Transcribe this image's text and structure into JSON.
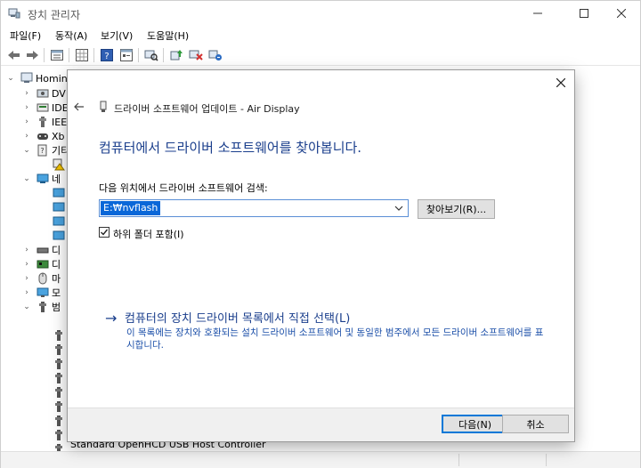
{
  "window": {
    "title": "장치 관리자"
  },
  "menu": {
    "items": [
      "파일(F)",
      "동작(A)",
      "보기(V)",
      "도움말(H)"
    ]
  },
  "toolbar": {
    "buttons": [
      "back-arrow-icon",
      "forward-arrow-icon",
      "properties-icon",
      "grid-icon",
      "help-icon",
      "details-icon",
      "scan-hardware-icon",
      "update-driver-icon",
      "disable-device-icon",
      "uninstall-device-icon"
    ]
  },
  "tree": {
    "root": "Homin",
    "items": [
      {
        "label": "DV",
        "icon": "dvd-drive-icon",
        "expanded": false
      },
      {
        "label": "IDE",
        "icon": "ide-controller-icon",
        "expanded": false
      },
      {
        "label": "IEE",
        "icon": "usb-controller-icon",
        "expanded": false
      },
      {
        "label": "Xb",
        "icon": "gamepad-icon",
        "expanded": false
      },
      {
        "label": "기티",
        "icon": "other-devices-icon",
        "expanded": true
      },
      {
        "label": "",
        "icon": "warning-device-icon",
        "expanded": null
      },
      {
        "label": "네",
        "icon": "network-adapter-icon",
        "expanded": true
      },
      {
        "label": "",
        "icon": "network-card-icon",
        "expanded": null
      },
      {
        "label": "",
        "icon": "network-card-icon",
        "expanded": null
      },
      {
        "label": "",
        "icon": "network-card-icon",
        "expanded": null
      },
      {
        "label": "",
        "icon": "network-card-icon",
        "expanded": null
      },
      {
        "label": "디",
        "icon": "disk-drive-icon",
        "expanded": false
      },
      {
        "label": "디",
        "icon": "display-adapter-icon",
        "expanded": false
      },
      {
        "label": "마",
        "icon": "mouse-icon",
        "expanded": false
      },
      {
        "label": "모",
        "icon": "monitor-icon",
        "expanded": false
      },
      {
        "label": "범",
        "icon": "usb-bus-icon",
        "expanded": true
      }
    ],
    "last_visible": "Standard OpenHCD USB Host Controller"
  },
  "dialog": {
    "title": "드라이버 소프트웨어 업데이트 - Air Display",
    "heading": "컴퓨터에서 드라이버 소프트웨어를 찾아봅니다.",
    "search_label": "다음 위치에서 드라이버 소프트웨어 검색:",
    "path_value": "E:₩nvflash",
    "browse_label": "찾아보기(R)...",
    "include_subfolders_label": "하위 폴더 포함(I)",
    "include_subfolders_checked": true,
    "pick_arrow": "→",
    "pick_link": "컴퓨터의 장치 드라이버 목록에서 직접 선택(L)",
    "pick_desc": "이 목록에는 장치와 호환되는 설치 드라이버 소프트웨어 및 동일한 범주에서 모든 드라이버 소프트웨어를 표시합니다.",
    "next_label": "다음(N)",
    "cancel_label": "취소"
  },
  "colors": {
    "accent": "#0078d7",
    "heading": "#1a3e8c",
    "selection": "#0a67d8"
  }
}
